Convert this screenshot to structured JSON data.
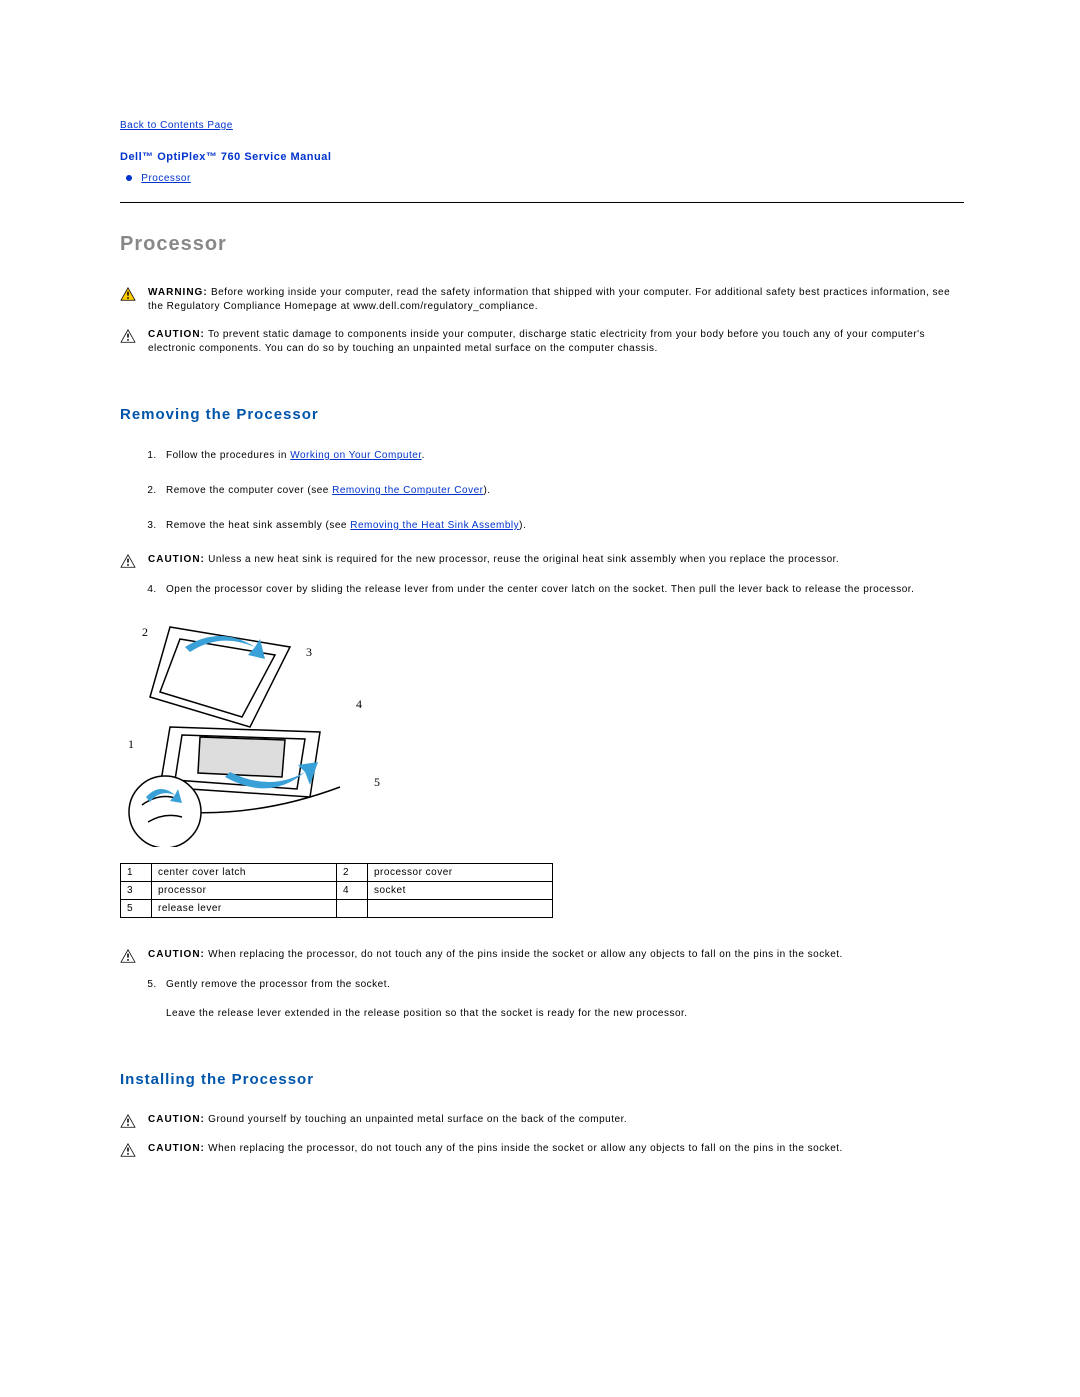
{
  "nav": {
    "back_link": "Back to Contents Page",
    "manual_title": "Dell™ OptiPlex™ 760 Service Manual",
    "toc_processor": "Processor"
  },
  "headings": {
    "processor": "Processor",
    "removing": "Removing the Processor",
    "installing": "Installing the Processor"
  },
  "notices": {
    "warning_label": "WARNING:",
    "caution_label": "CAUTION:",
    "warning_safety": "Before working inside your computer, read the safety information that shipped with your computer. For additional safety best practices information, see the Regulatory Compliance Homepage at www.dell.com/regulatory_compliance.",
    "caution_static": "To prevent static damage to components inside your computer, discharge static electricity from your body before you touch any of your computer's electronic components. You can do so by touching an unpainted metal surface on the computer chassis.",
    "caution_heatsink_reuse": "Unless a new heat sink is required for the new processor, reuse the original heat sink assembly when you replace the processor.",
    "caution_pins": "When replacing the processor, do not touch any of the pins inside the socket or allow any objects to fall on the pins in the socket.",
    "caution_ground": "Ground yourself by touching an unpainted metal surface on the back of the computer."
  },
  "steps": {
    "s1_before": "Follow the procedures in ",
    "s1_link": "Working on Your Computer",
    "s1_after": ".",
    "s2_before": "Remove the computer cover (see ",
    "s2_link": "Removing the Computer Cover",
    "s2_after": ").",
    "s3_before": "Remove the heat sink assembly (see ",
    "s3_link": "Removing the Heat Sink Assembly",
    "s3_after": ").",
    "s4": "Open the processor cover by sliding the release lever from under the center cover latch on the socket. Then pull the lever back to release the processor.",
    "s5": "Gently remove the processor from the socket.",
    "s5_note": "Leave the release lever extended in the release position so that the socket is ready for the new processor."
  },
  "callouts": {
    "c1": "1",
    "c2": "2",
    "c3": "3",
    "c4": "4",
    "c5": "5"
  },
  "parts_table": [
    {
      "n": "1",
      "label": "center cover latch"
    },
    {
      "n": "2",
      "label": "processor cover"
    },
    {
      "n": "3",
      "label": "processor"
    },
    {
      "n": "4",
      "label": "socket"
    },
    {
      "n": "5",
      "label": "release lever"
    }
  ]
}
